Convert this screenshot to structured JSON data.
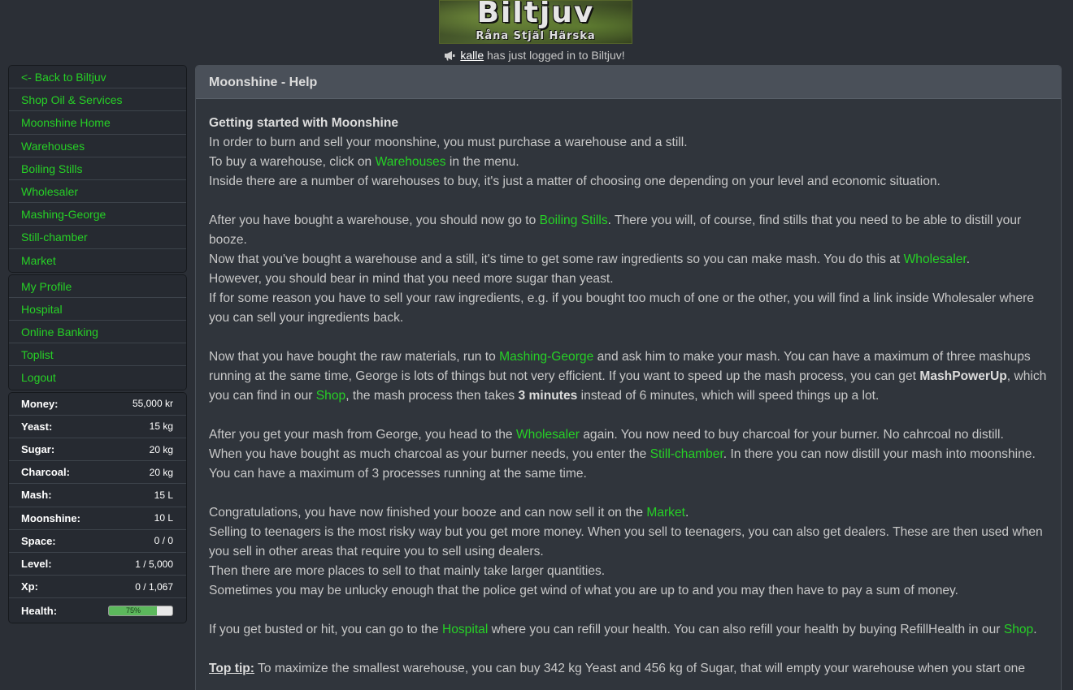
{
  "logo": {
    "title": "Biltjuv",
    "subtitle": "Råna Stjäl Härska"
  },
  "announcement": {
    "user": "kalle",
    "text": " has just logged in to Biltjuv!"
  },
  "menu_main": [
    "<- Back to Biltjuv",
    "Shop Oil & Services",
    "Moonshine Home",
    "Warehouses",
    "Boiling Stills",
    "Wholesaler",
    "Mashing-George",
    "Still-chamber",
    "Market"
  ],
  "menu_account": [
    "My Profile",
    "Hospital",
    "Online Banking",
    "Toplist",
    "Logout"
  ],
  "stats": [
    {
      "label": "Money:",
      "value": "55,000 kr"
    },
    {
      "label": "Yeast:",
      "value": "15 kg"
    },
    {
      "label": "Sugar:",
      "value": "20 kg"
    },
    {
      "label": "Charcoal:",
      "value": "20 kg"
    },
    {
      "label": "Mash:",
      "value": "15 L"
    },
    {
      "label": "Moonshine:",
      "value": "10 L"
    },
    {
      "label": "Space:",
      "value": "0 / 0"
    },
    {
      "label": "Level:",
      "value": "1 / 5,000"
    },
    {
      "label": "Xp:",
      "value": "0 / 1,067"
    }
  ],
  "health": {
    "label": "Health:",
    "percent": 75,
    "text": "75%"
  },
  "colors": {
    "link": "#26d026",
    "background": "#2b2f36",
    "panel": "#30353c",
    "header": "#4a5059"
  },
  "panel": {
    "title": "Moonshine - Help",
    "p1": {
      "heading": "Getting started with Moonshine",
      "l1": "In order to burn and sell your moonshine, you must purchase a warehouse and a still.",
      "l2a": "To buy a warehouse, click on ",
      "l2link": "Warehouses",
      "l2b": " in the menu.",
      "l3": "Inside there are a number of warehouses to buy, it's just a matter of choosing one depending on your level and economic situation."
    },
    "p2": {
      "a": "After you have bought a warehouse, you should now go to ",
      "link1": "Boiling Stills",
      "b": ". There you will, of course, find stills that you need to be able to distill your booze.",
      "c": "Now that you've bought a warehouse and a still, it's time to get some raw ingredients so you can make mash. You do this at ",
      "link2": "Wholesaler",
      "d": ".",
      "e": "However, you should bear in mind that you need more sugar than yeast.",
      "f": "If for some reason you have to sell your raw ingredients, e.g. if you bought too much of one or the other, you will find a link inside Wholesaler where you can sell your ingredients back."
    },
    "p3": {
      "a": "Now that you have bought the raw materials, run to ",
      "link1": "Mashing-George",
      "b": " and ask him to make your mash. You can have a maximum of three mashups running at the same time, George is lots of things but not very efficient. If you want to speed up the mash process, you can get ",
      "bold1": "MashPowerUp",
      "c": ", which you can find in our ",
      "link2": "Shop",
      "d": ", the mash process then takes ",
      "bold2": "3 minutes",
      "e": " instead of 6 minutes, which will speed things up a lot."
    },
    "p4": {
      "a": "After you get your mash from George, you head to the ",
      "link1": "Wholesaler",
      "b": " again. You now need to buy charcoal for your burner. No cahrcoal no distill.",
      "c": "When you have bought as much charcoal as your burner needs, you enter the ",
      "link2": "Still-chamber",
      "d": ". In there you can now distill your mash into moonshine. You can have a maximum of 3 processes running at the same time."
    },
    "p5": {
      "a": "Congratulations, you have now finished your booze and can now sell it on the ",
      "link1": "Market",
      "b": ".",
      "c": "Selling to teenagers is the most risky way but you get more money. When you sell to teenagers, you can also get dealers. These are then used when you sell in other areas that require you to sell using dealers.",
      "d": "Then there are more places to sell to that mainly take larger quantities.",
      "e": "Sometimes you may be unlucky enough that the police get wind of what you are up to and you may then have to pay a sum of money."
    },
    "p6": {
      "a": "If you get busted or hit, you can go to the ",
      "link1": "Hospital",
      "b": " where you can refill your health. You can also refill your health by buying RefillHealth in our ",
      "link2": "Shop",
      "c": "."
    },
    "p7": {
      "bold": "Top tip:",
      "text": " To maximize the smallest warehouse, you can buy 342 kg Yeast and 456 kg of Sugar, that will empty your warehouse when you start one"
    }
  }
}
